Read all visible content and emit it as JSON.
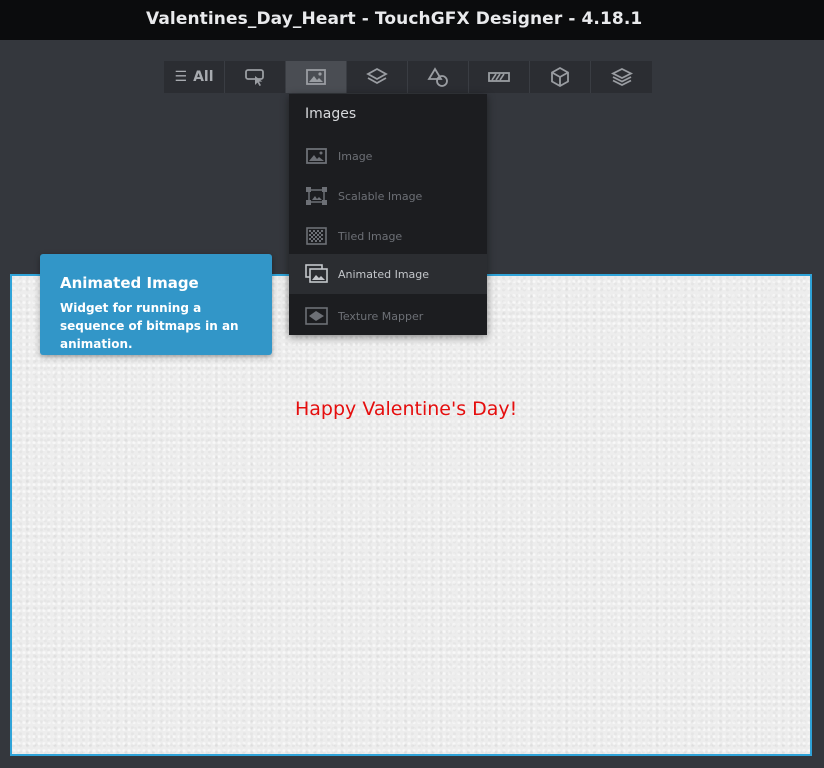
{
  "window": {
    "title": "Valentines_Day_Heart - TouchGFX Designer - 4.18.1"
  },
  "toolbar": {
    "all_label": "All",
    "categories": [
      {
        "icon": "hamburger-menu-icon",
        "label": "All"
      },
      {
        "icon": "touch-button-icon"
      },
      {
        "icon": "image-icon",
        "active": true
      },
      {
        "icon": "layers-icon"
      },
      {
        "icon": "shapes-icon"
      },
      {
        "icon": "progress-indicator-icon"
      },
      {
        "icon": "3d-cube-icon"
      },
      {
        "icon": "stack-icon"
      }
    ]
  },
  "images_menu": {
    "header": "Images",
    "items": [
      {
        "label": "Image",
        "icon": "image-icon"
      },
      {
        "label": "Scalable Image",
        "icon": "scalable-image-icon"
      },
      {
        "label": "Tiled Image",
        "icon": "tiled-image-icon"
      },
      {
        "label": "Animated Image",
        "icon": "animated-image-icon",
        "highlighted": true
      },
      {
        "label": "Texture Mapper",
        "icon": "texture-mapper-icon"
      }
    ]
  },
  "tooltip": {
    "title": "Animated Image",
    "description": "Widget for running a sequence of bitmaps in an animation."
  },
  "canvas": {
    "text": "Happy Valentine's Day!",
    "text_color": "#e50e0e",
    "border_color": "#2fa3d8"
  }
}
